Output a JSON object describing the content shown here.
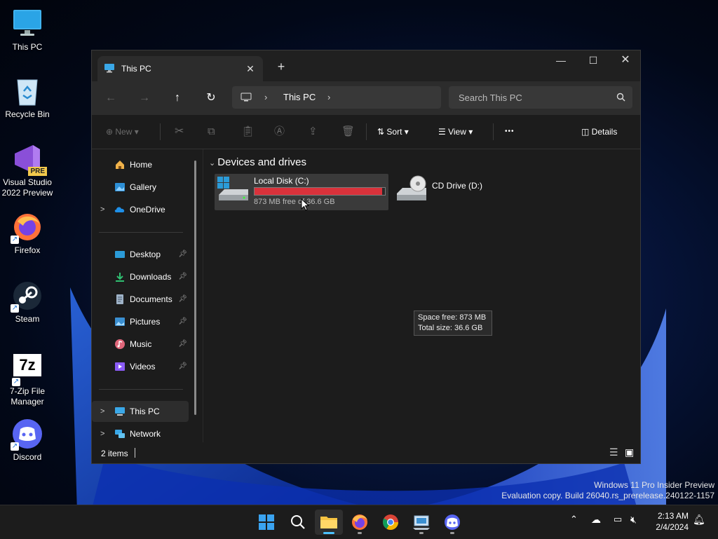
{
  "desktop": {
    "icons": [
      {
        "label": "This PC",
        "icon": "monitor-icon"
      },
      {
        "label": "Recycle Bin",
        "icon": "recycle-bin-icon"
      },
      {
        "label": "Visual Studio 2022 Preview",
        "icon": "visual-studio-icon",
        "badge": "PRE"
      },
      {
        "label": "Firefox",
        "icon": "firefox-icon"
      },
      {
        "label": "Steam",
        "icon": "steam-icon"
      },
      {
        "label": "7-Zip File Manager",
        "icon": "7zip-icon",
        "glyph": "7z"
      },
      {
        "label": "Discord",
        "icon": "discord-icon"
      }
    ]
  },
  "window": {
    "tab_title": "This PC",
    "new_tab": "+",
    "address": {
      "root_chevron": "›",
      "location": "This PC",
      "end_chevron": "›"
    },
    "search_placeholder": "Search This PC",
    "toolbar": {
      "new_label": "New",
      "sort_label": "Sort",
      "view_label": "View",
      "more_label": "•••",
      "details_label": "Details"
    },
    "nav": {
      "items": [
        {
          "label": "Home"
        },
        {
          "label": "Gallery"
        },
        {
          "label": "OneDrive"
        },
        {
          "label": "Desktop"
        },
        {
          "label": "Downloads"
        },
        {
          "label": "Documents"
        },
        {
          "label": "Pictures"
        },
        {
          "label": "Music"
        },
        {
          "label": "Videos"
        },
        {
          "label": "This PC"
        },
        {
          "label": "Network"
        }
      ]
    },
    "content": {
      "group_label": "Devices and drives",
      "drives": [
        {
          "name": "Local Disk (C:)",
          "space_text": "873 MB free of 36.6 GB",
          "used_fraction": 0.977
        },
        {
          "name": "CD Drive (D:)"
        }
      ],
      "tooltip": {
        "line1": "Space free: 873 MB",
        "line2": "Total size: 36.6 GB"
      }
    },
    "status": {
      "items_count": "2 items"
    }
  },
  "watermark": {
    "line1": "Windows 11 Pro Insider Preview",
    "line2": "Evaluation copy. Build 26040.rs_prerelease.240122-1157"
  },
  "taskbar": {
    "time": "2:13 AM",
    "date": "2/4/2024"
  },
  "colors": {
    "accent": "#4cc2ff",
    "usage_bar": "#d9323b",
    "window_bg": "#1c1c1c"
  }
}
